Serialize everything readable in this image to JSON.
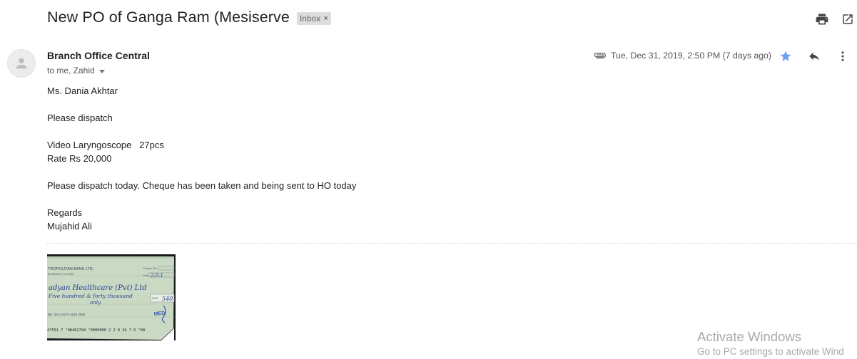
{
  "email": {
    "subject": "New PO of Ganga Ram (Mesiserve",
    "label": "Inbox",
    "label_close": "×",
    "sender": "Branch Office Central",
    "recipients": "to me, Zahid",
    "date": "Tue, Dec 31, 2019, 2:50 PM (7 days ago)",
    "starred": true,
    "star_color": "#6e9ff2",
    "body_lines": [
      "Ms. Dania Akhtar",
      "",
      "Please dispatch",
      "",
      "Video Laryngoscope   27pcs",
      "Rate Rs 20,000",
      "",
      "Please dispatch today. Cheque has been taken and being sent to HO today",
      "",
      "Regards",
      "Mujahid Ali"
    ]
  },
  "icons": {
    "print": "print-icon",
    "open_new_window": "open-in-new-window-icon",
    "attachment": "paperclip-icon",
    "star": "star-icon",
    "reply": "reply-icon",
    "more": "more-vert-icon",
    "avatar": "person-icon"
  },
  "attachment": {
    "kind": "cheque-image-thumbnail",
    "bank_name": "TROPOLITAN BANK LTD.",
    "branch": "M BRANCH LAHORE",
    "cheque_no_label": "Cheque No.",
    "date_label": "Date",
    "date_value": "2.0.1",
    "payee": "adyan Healthcare (Pvt) Ltd",
    "amount_words": "Five hundred & forty thousand",
    "amount_words_2": "only.",
    "amount_label": "PKR",
    "amount_value": "540",
    "account_no": "NK: 0412 0275 4010 2654",
    "micr": "47551 7 \"08402794 \"0000000 2 2 0 26 7 6 \"08",
    "stamp": "MED"
  },
  "watermark": {
    "line1": "Activate Windows",
    "line2": "Go to PC settings to activate Wind"
  }
}
